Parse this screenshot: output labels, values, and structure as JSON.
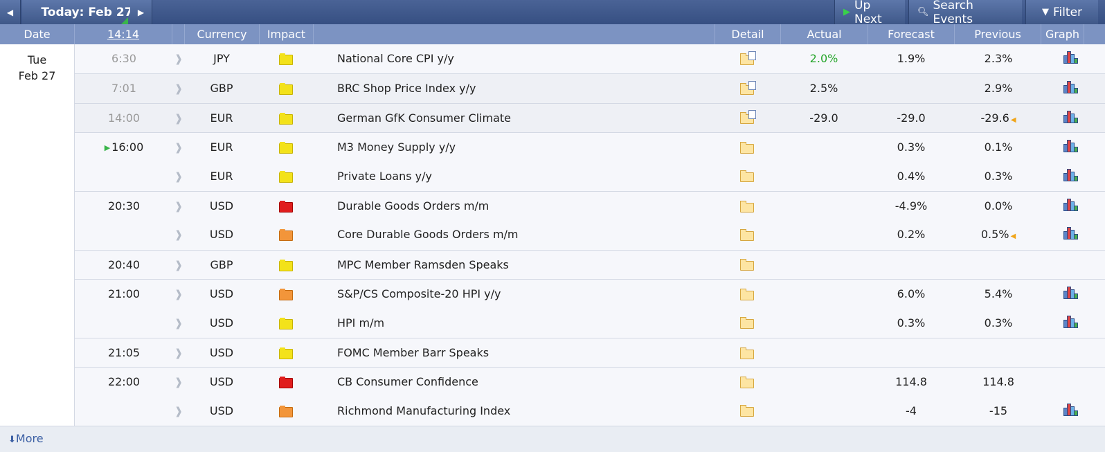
{
  "toolbar": {
    "prev_icon": "caret-left-icon",
    "today_label": "Today: Feb 27",
    "next_icon": "caret-right-icon",
    "up_next_label": "Up Next",
    "search_label": "Search Events",
    "filter_label": "Filter"
  },
  "header": {
    "date": "Date",
    "clock": "14:14",
    "currency": "Currency",
    "impact": "Impact",
    "detail": "Detail",
    "actual": "Actual",
    "forecast": "Forecast",
    "previous": "Previous",
    "graph": "Graph"
  },
  "date_cell": {
    "day": "Tue",
    "date": "Feb 27"
  },
  "colors": {
    "impact_low": "#f3e21a",
    "impact_medium": "#f2953a",
    "impact_high": "#e01d1d",
    "better_than_expected": "#25a52a",
    "accent": "#3f5889"
  },
  "events": [
    {
      "time": "6:30",
      "currency": "JPY",
      "impact": "low",
      "event": "National Core CPI y/y",
      "actual": "2.0%",
      "forecast": "1.9%",
      "previous": "2.3%",
      "graph": true
    },
    {
      "time": "7:01",
      "currency": "GBP",
      "impact": "low",
      "event": "BRC Shop Price Index y/y",
      "actual": "2.5%",
      "forecast": "",
      "previous": "2.9%",
      "graph": true
    },
    {
      "time": "14:00",
      "currency": "EUR",
      "impact": "low",
      "event": "German GfK Consumer Climate",
      "actual": "-29.0",
      "forecast": "-29.0",
      "previous": "-29.6",
      "graph": true
    },
    {
      "time": "16:00",
      "currency": "EUR",
      "impact": "low",
      "event": "M3 Money Supply y/y",
      "actual": "",
      "forecast": "0.3%",
      "previous": "0.1%",
      "graph": true
    },
    {
      "time": "",
      "currency": "EUR",
      "impact": "low",
      "event": "Private Loans y/y",
      "actual": "",
      "forecast": "0.4%",
      "previous": "0.3%",
      "graph": true
    },
    {
      "time": "20:30",
      "currency": "USD",
      "impact": "high",
      "event": "Durable Goods Orders m/m",
      "actual": "",
      "forecast": "-4.9%",
      "previous": "0.0%",
      "graph": true
    },
    {
      "time": "",
      "currency": "USD",
      "impact": "medium",
      "event": "Core Durable Goods Orders m/m",
      "actual": "",
      "forecast": "0.2%",
      "previous": "0.5%",
      "graph": true
    },
    {
      "time": "20:40",
      "currency": "GBP",
      "impact": "low",
      "event": "MPC Member Ramsden Speaks",
      "actual": "",
      "forecast": "",
      "previous": "",
      "graph": false
    },
    {
      "time": "21:00",
      "currency": "USD",
      "impact": "medium",
      "event": "S&P/CS Composite-20 HPI y/y",
      "actual": "",
      "forecast": "6.0%",
      "previous": "5.4%",
      "graph": true
    },
    {
      "time": "",
      "currency": "USD",
      "impact": "low",
      "event": "HPI m/m",
      "actual": "",
      "forecast": "0.3%",
      "previous": "0.3%",
      "graph": true
    },
    {
      "time": "21:05",
      "currency": "USD",
      "impact": "low",
      "event": "FOMC Member Barr Speaks",
      "actual": "",
      "forecast": "",
      "previous": "",
      "graph": false
    },
    {
      "time": "22:00",
      "currency": "USD",
      "impact": "high",
      "event": "CB Consumer Confidence",
      "actual": "",
      "forecast": "114.8",
      "previous": "114.8",
      "graph": false
    },
    {
      "time": "",
      "currency": "USD",
      "impact": "medium",
      "event": "Richmond Manufacturing Index",
      "actual": "",
      "forecast": "-4",
      "previous": "-15",
      "graph": true
    }
  ],
  "footer": {
    "more_label": "More"
  }
}
